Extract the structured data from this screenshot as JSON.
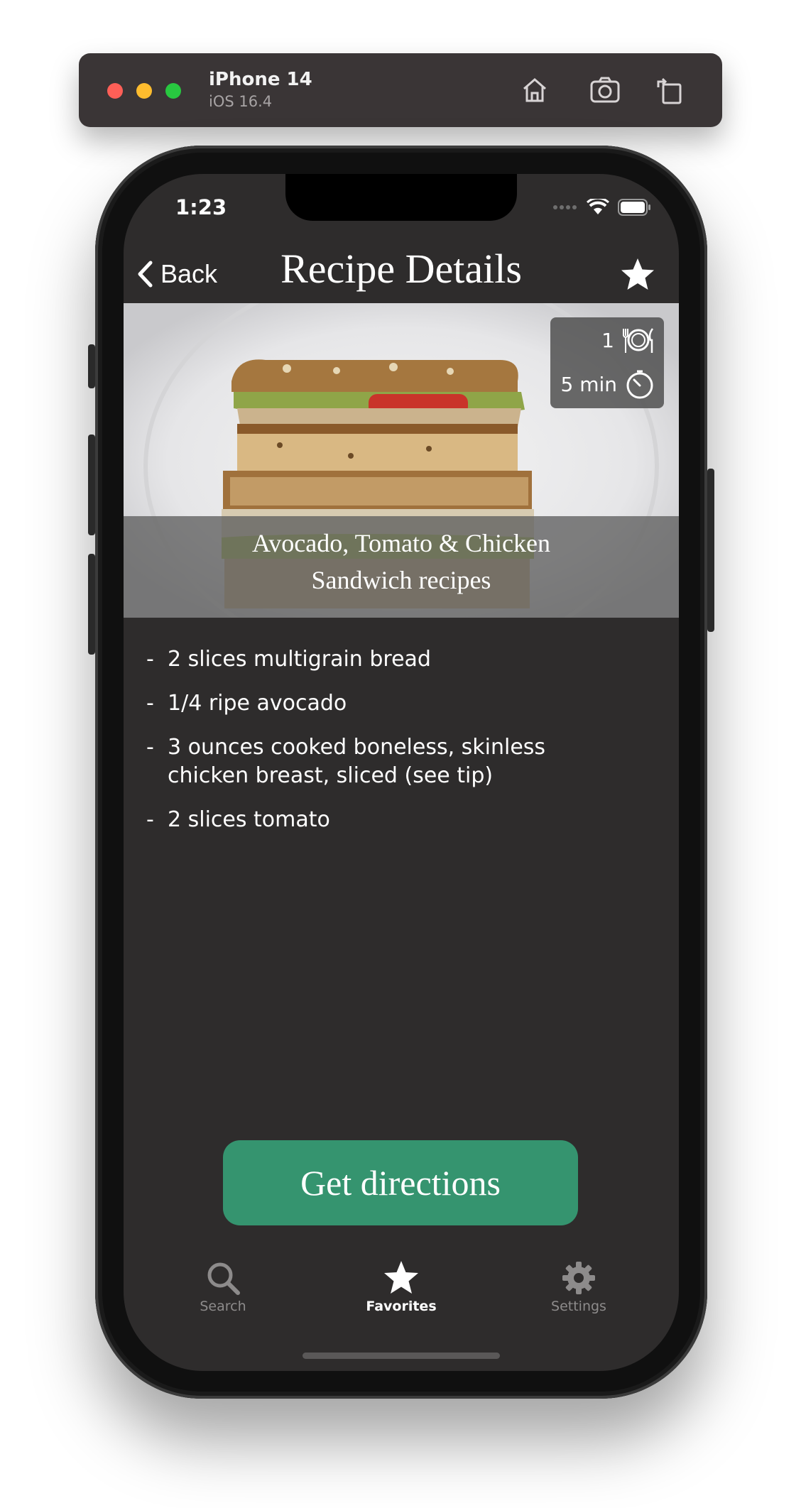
{
  "simulator": {
    "device_name": "iPhone 14",
    "os_version": "iOS 16.4",
    "buttons": [
      "home-icon",
      "screenshot-icon",
      "rotate-icon"
    ]
  },
  "status_bar": {
    "time": "1:23"
  },
  "nav": {
    "back_label": "Back",
    "title": "Recipe Details",
    "favorite_icon": "star-icon"
  },
  "recipe": {
    "title_line1": "Avocado, Tomato & Chicken",
    "title_line2": "Sandwich recipes",
    "servings": "1",
    "time": "5 min",
    "ingredients": [
      "2 slices multigrain bread",
      "1/4 ripe avocado",
      "3 ounces cooked boneless, skinless chicken breast, sliced (see tip)",
      "2 slices tomato"
    ]
  },
  "directions_button": "Get directions",
  "tab_bar": {
    "tabs": [
      {
        "label": "Search",
        "icon": "search-icon",
        "active": false
      },
      {
        "label": "Favorites",
        "icon": "star-icon",
        "active": true
      },
      {
        "label": "Settings",
        "icon": "gear-icon",
        "active": false
      }
    ]
  },
  "colors": {
    "screen_bg": "#2e2c2c",
    "accent_button": "#35946f",
    "tab_inactive": "#8d8b8b",
    "tab_active": "#ffffff"
  }
}
